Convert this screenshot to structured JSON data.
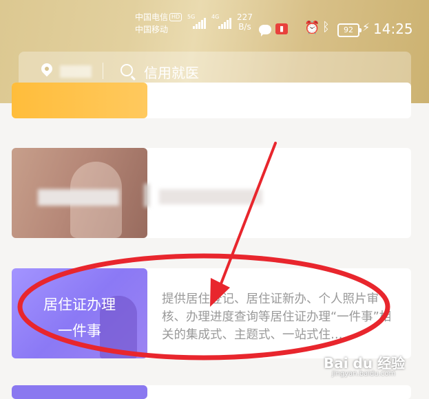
{
  "status_bar": {
    "carrier1": "中国电信",
    "carrier1_badge": "HD",
    "carrier2": "中国移动",
    "signal1_label": "5G",
    "signal2_label": "4G",
    "speed_value": "227",
    "speed_unit": "B/s",
    "battery": "92",
    "time": "14:25"
  },
  "search": {
    "placeholder": "信用就医"
  },
  "services": [
    {
      "title": "",
      "description": ""
    },
    {
      "title": "",
      "description": ""
    },
    {
      "title_line1": "居住证办理",
      "title_line2": "一件事",
      "description": "提供居住登记、居住证新办、个人照片审核、办理进度查询等居住证办理“一件事”相关的集成式、主题式、一站式住…"
    }
  ],
  "watermark": {
    "main": "Bai du 经验",
    "sub": "jingyan.baidu.com"
  },
  "colors": {
    "header": "#dcc891",
    "annotation": "#e8262d",
    "card3_accent": "#8b79f5"
  }
}
